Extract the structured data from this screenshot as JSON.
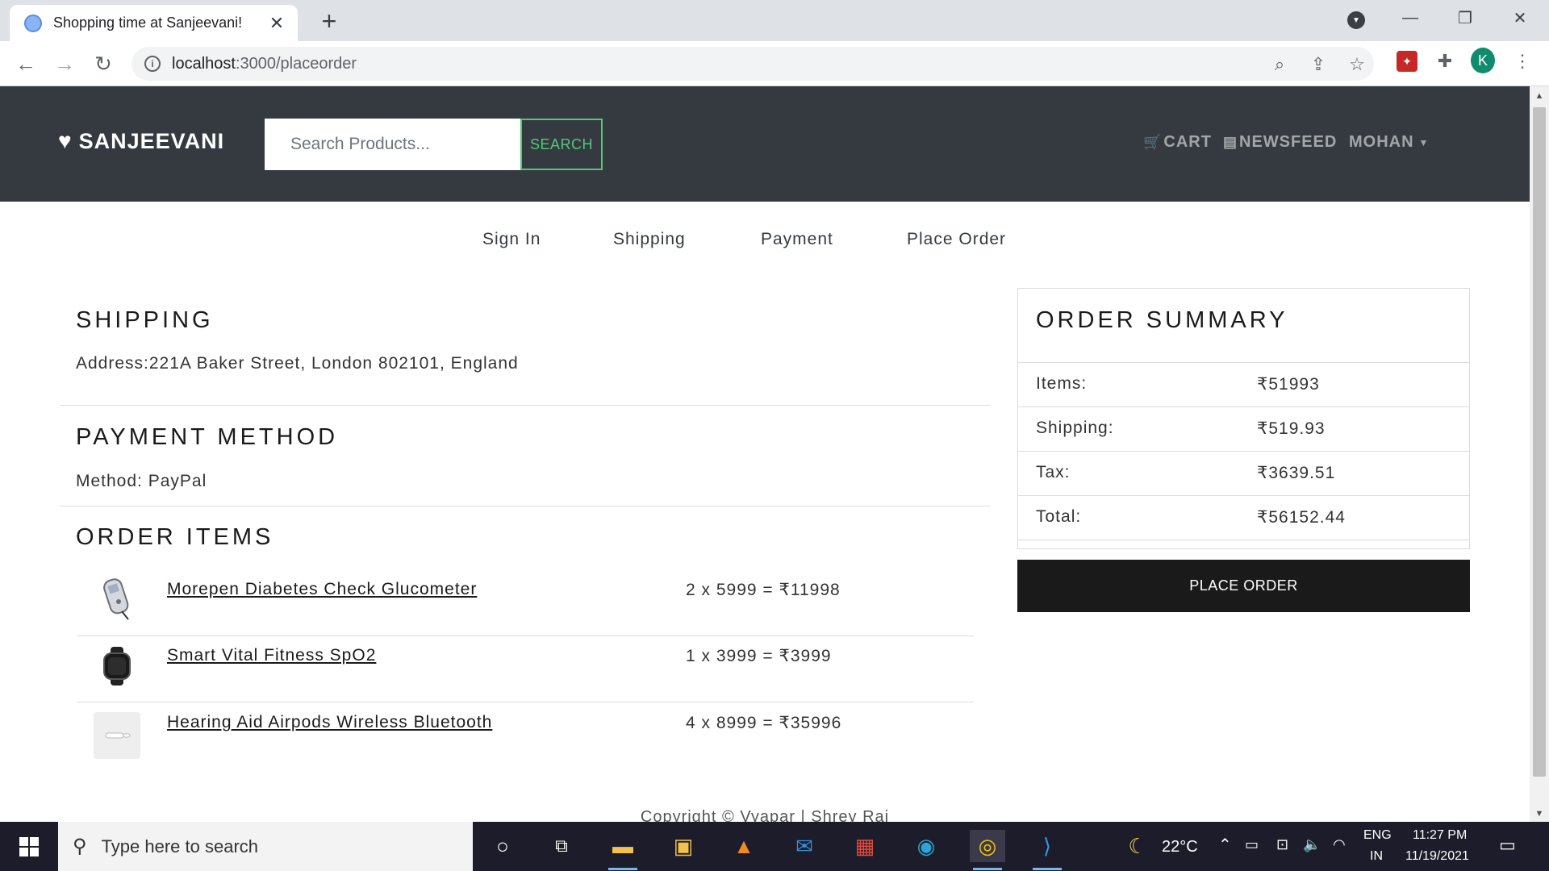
{
  "browser": {
    "tab_title": "Shopping time at Sanjeevani!",
    "tab_close": "✕",
    "new_tab": "+",
    "url_host": "localhost",
    "url_path": ":3000/placeorder"
  },
  "site": {
    "brand": "SANJEEVANI",
    "search_placeholder": "Search Products...",
    "search_button": "SEARCH",
    "nav": {
      "cart": "CART",
      "newsfeed": "NEWSFEED",
      "user": "MOHAN"
    }
  },
  "steps": [
    "Sign In",
    "Shipping",
    "Payment",
    "Place Order"
  ],
  "shipping": {
    "title": "SHIPPING",
    "address": "Address:221A Baker Street, London 802101, England"
  },
  "payment": {
    "title": "PAYMENT METHOD",
    "method": "Method: PayPal"
  },
  "order_items": {
    "title": "ORDER ITEMS",
    "items": [
      {
        "name": "Morepen Diabetes Check Glucometer",
        "price": "2 x 5999 = ₹11998"
      },
      {
        "name": "Smart Vital Fitness SpO2",
        "price": "1 x 3999 = ₹3999"
      },
      {
        "name": "Hearing Aid Airpods Wireless Bluetooth",
        "price": "4 x 8999 = ₹35996"
      }
    ]
  },
  "summary": {
    "title": "ORDER SUMMARY",
    "rows": [
      {
        "label": "Items:",
        "value": "₹51993"
      },
      {
        "label": "Shipping:",
        "value": "₹519.93"
      },
      {
        "label": "Tax:",
        "value": "₹3639.51"
      },
      {
        "label": "Total:",
        "value": "₹56152.44"
      }
    ],
    "button": "PLACE ORDER"
  },
  "footer": "Copyright © Vyapar | Shrey Raj",
  "taskbar": {
    "search_text": "Type here to search",
    "weather": "22°C",
    "lang_top": "ENG",
    "lang_bottom": "IN",
    "time": "11:27 PM",
    "date": "11/19/2021"
  },
  "extension_avatar": "K"
}
